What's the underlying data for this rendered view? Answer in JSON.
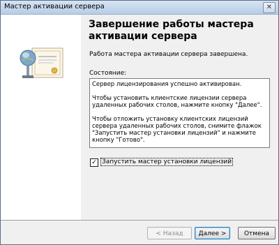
{
  "window": {
    "title": "Мастер активации сервера",
    "close_glyph": "✕"
  },
  "content": {
    "heading": "Завершение работы мастера активации сервера",
    "completed_text": "Работа мастера активации сервера завершена.",
    "status_label": "Состояние:",
    "status_text": "Сервер лицензирования успешно активирован.\n\nЧтобы установить клиентские лицензии сервера удаленных рабочих столов, нажмите кнопку \"Далее\".\n\nЧтобы отложить установку клиентских лицензий сервера удаленных рабочих столов, снимите флажок \"Запустить мастер установки лицензий\" и нажмите кнопку \"Готово\".",
    "checkbox_label": "Запустить мастер установки лицензий",
    "checkbox_checked": true,
    "checkbox_glyph": "✓"
  },
  "footer": {
    "back_label": "< Назад",
    "next_label": "Далее >",
    "cancel_label": "Отмена"
  },
  "illustration": {
    "icon": "server-license-icon"
  }
}
